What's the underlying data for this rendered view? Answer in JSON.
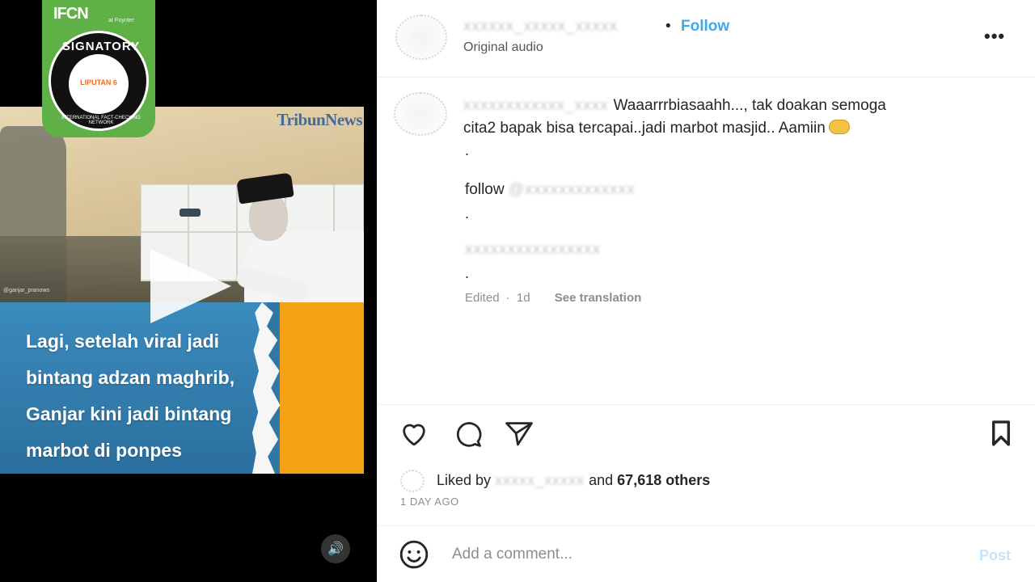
{
  "media": {
    "watermark": "TribunNews",
    "credit": "@ganjar_pranowo",
    "caption_lines": [
      "Lagi, setelah viral jadi",
      "bintang adzan maghrib,",
      "Ganjar kini jadi bintang",
      "marbot di ponpes"
    ],
    "badge": {
      "ifcn": "IFCN",
      "ifcn_sub": "at Poynter",
      "signatory": "SIGNATORY",
      "org": "LIPUTAN 6",
      "network": "INTERNATIONAL FACT-CHECKING NETWORK"
    },
    "volume_icon": "🔊"
  },
  "header": {
    "username": "xxxxxx_xxxxx_xxxxx",
    "separator": "•",
    "follow_label": "Follow",
    "audio_label": "Original audio",
    "more_label": "•••"
  },
  "comment": {
    "username": "xxxxxxxxxxxx_xxxx",
    "line1": "Waaarrrbiasaahh..., tak doakan semoga",
    "line2": "cita2 bapak bisa tercapai..jadi marbot masjid.. Aamiin",
    "dot": ".",
    "follow_word": "follow",
    "follow_handle": "@xxxxxxxxxxxxx",
    "blur_line": "xxxxxxxxxxxxxxxx",
    "edited_label": "Edited",
    "meta_sep": "·",
    "age": "1d",
    "translate_label": "See translation"
  },
  "actions": {
    "liked_by_label": "Liked by",
    "liked_by_user": "xxxxx_xxxxx",
    "and_label": "and",
    "others_label": "67,618 others",
    "timestamp": "1 DAY AGO"
  },
  "comment_input": {
    "placeholder": "Add a comment...",
    "post_label": "Post"
  },
  "colors": {
    "follow_blue": "#3fa9e8",
    "caption_blue": "#2f78a6",
    "caption_orange": "#f5a214",
    "badge_green": "#5fb046"
  }
}
